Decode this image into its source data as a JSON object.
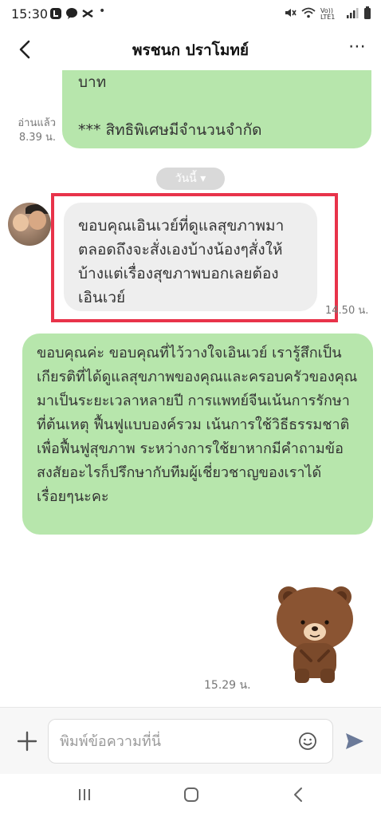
{
  "status_bar": {
    "time": "15:30",
    "icons_left": [
      "line-notification-icon",
      "line-chat-icon",
      "capcut-icon",
      "dot-icon"
    ],
    "signal_text": "Vo)) LTE1"
  },
  "header": {
    "title": "พรชนก ปราโมทย์",
    "more": "⋯"
  },
  "messages": {
    "m1": {
      "text": "บาท\n\n*** สิทธิพิเศษมีจำนวนจำกัด",
      "read_label": "อ่านแล้ว",
      "time": "8.39 น."
    },
    "date_chip": "วันนี้ ▾",
    "m2": {
      "text": "ขอบคุณเอินเวย์ที่ดูแลสุขภาพมาตลอดถึงจะสั่งเองบ้างน้องๆสั่งให้บ้างแต่เรื่องสุขภาพบอกเลยต้องเอินเวย์",
      "time": "14.50 น."
    },
    "m3": {
      "text": "ขอบคุณค่ะ ขอบคุณที่ไว้วางใจเอินเวย์ เรารู้สึกเป็นเกียรติที่ได้ดูแลสุขภาพของคุณและครอบครัวของคุณมาเป็นระยะเวลาหลายปี การแพทย์จีนเน้นการรักษาที่ต้นเหตุ ฟื้นฟูแบบองค์รวม เน้นการใช้วิธีธรรมชาติเพื่อฟื้นฟูสุขภาพ ระหว่างการใช้ยาหากมีคำถามข้อสงสัยอะไรก็ปรึกษากับทีมผู้เชี่ยวชาญของเราได้เรื่อยๆนะคะ"
    },
    "sticker": {
      "name": "brown-bear-sticker",
      "time": "15.29 น."
    }
  },
  "input": {
    "placeholder": "พิมพ์ข้อความที่นี่",
    "value": ""
  },
  "colors": {
    "bubble_green": "#b7e6ac",
    "bubble_gray": "#eeeeee",
    "highlight": "#e8334a"
  }
}
